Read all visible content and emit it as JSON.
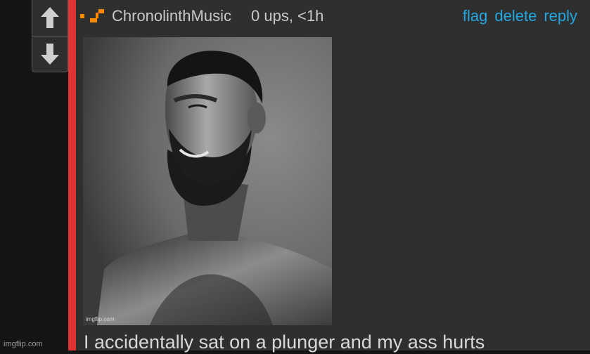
{
  "vote": {
    "up_icon": "arrow-up-icon",
    "down_icon": "arrow-down-icon"
  },
  "comment": {
    "username": "ChronolinthMusic",
    "meta": "0 ups, <1h",
    "actions": [
      "flag",
      "delete",
      "reply"
    ],
    "image_watermark": "imgflip.com",
    "text": "I accidentally sat on a plunger and my ass hurts"
  },
  "footer": {
    "watermark": "imgflip.com"
  },
  "colors": {
    "accent_red": "#e03434",
    "link_blue": "#22a7e0",
    "user_icon_orange": "#ff8a00"
  }
}
